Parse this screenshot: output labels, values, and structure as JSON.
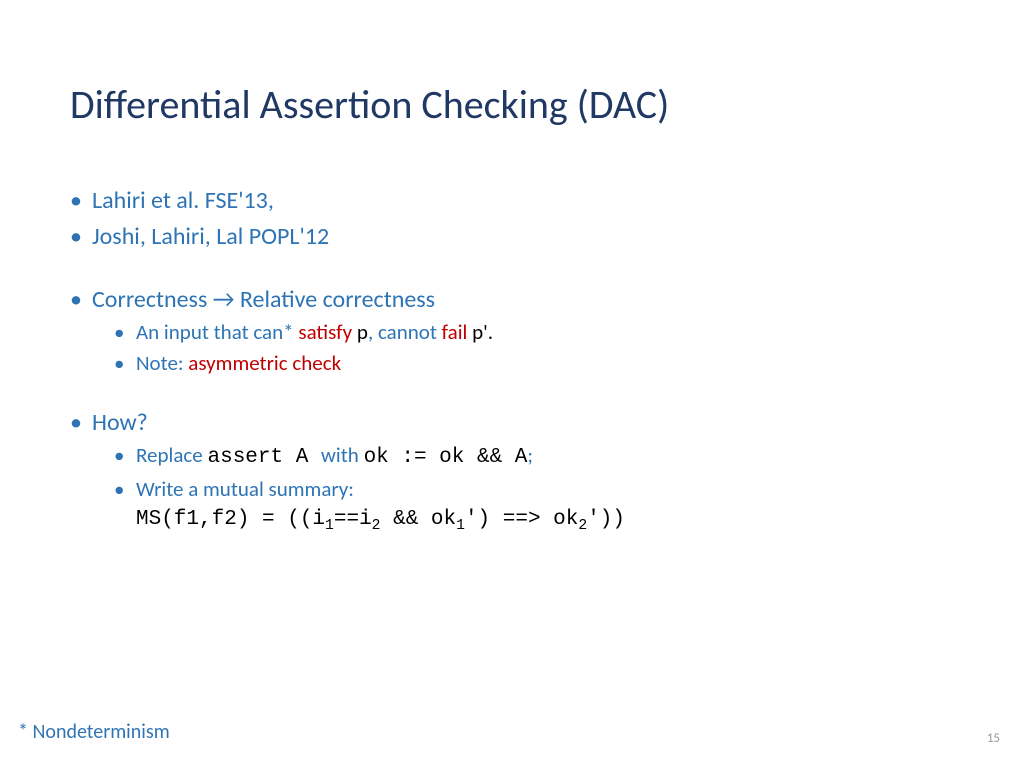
{
  "title": "Differential Assertion Checking (DAC)",
  "bullets": {
    "ref1": "Lahiri et al. FSE'13,",
    "ref2": "Joshi, Lahiri, Lal POPL'12",
    "correctness_pre": "Correctness ",
    "arrow": "→",
    "correctness_post": " Relative correctness",
    "input_line": {
      "a": "An input that can* ",
      "satisfy": "satisfy",
      "p": " p",
      "comma": ", ",
      "cannot": "cannot",
      "fail": " fail",
      "pprime": " p'."
    },
    "note_label": "Note: ",
    "asym": "asymmetric check",
    "how": "How?",
    "replace_pre": "Replace ",
    "assert_code": "assert A ",
    "with": " with ",
    "ok_code": "ok := ok && A",
    "semicolon": ";",
    "summary_label": "Write a mutual summary:",
    "ms_pre": "MS(f1,f2) = ((i",
    "sub1": "1",
    "eq": "==i",
    "sub2": "2",
    "and_ok": " && ok",
    "sub3": "1",
    "prime_imp": "') ==> ok",
    "sub4": "2",
    "tail": "'))"
  },
  "footnote": "* Nondeterminism",
  "page": "15"
}
